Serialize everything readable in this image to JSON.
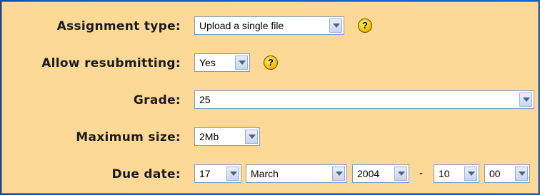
{
  "form": {
    "assignment_type": {
      "label": "Assignment type:",
      "value": "Upload a single file",
      "help_glyph": "?"
    },
    "allow_resubmitting": {
      "label": "Allow resubmitting:",
      "value": "Yes",
      "help_glyph": "?"
    },
    "grade": {
      "label": "Grade:",
      "value": "25"
    },
    "maximum_size": {
      "label": "Maximum size:",
      "value": "2Mb"
    },
    "due_date": {
      "label": "Due date:",
      "day": "17",
      "month": "March",
      "year": "2004",
      "separator": "-",
      "hour": "10",
      "minute": "00"
    }
  },
  "colors": {
    "panel_background": "#fcd996",
    "page_background": "#1365cc",
    "help_icon": "#f2c200"
  },
  "icons": {
    "help": "help-icon",
    "dropdown": "chevron-down-icon"
  }
}
